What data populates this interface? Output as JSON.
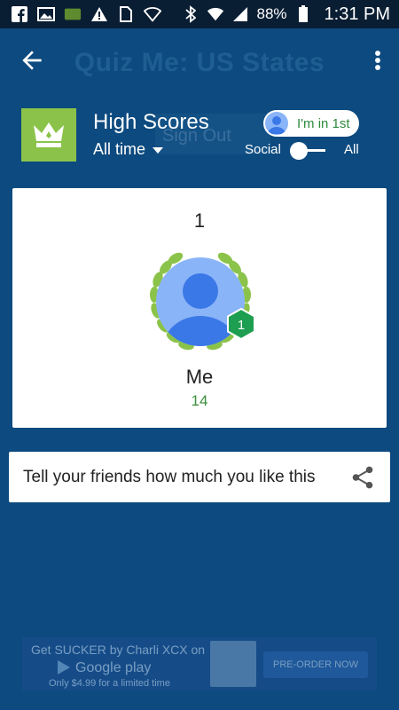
{
  "status_bar": {
    "battery": "88%",
    "time": "1:31 PM",
    "notification_badge": "88",
    "icons": [
      "facebook-icon",
      "image-icon",
      "badge-88-icon",
      "warning-icon",
      "sim-icon",
      "wifi-icon"
    ],
    "right_icons": [
      "bluetooth-icon",
      "wifi-icon",
      "signal-icon",
      "battery-icon"
    ]
  },
  "app_bar": {
    "title": "Quiz Me: US States",
    "back_icon": "arrow-back-icon",
    "menu_icon": "more-vert-icon"
  },
  "header": {
    "title": "High Scores",
    "time_filter": "All time",
    "ghost_button": "Sign Out",
    "im_first_label": "I'm in 1st",
    "toggle_left": "Social",
    "toggle_right": "All"
  },
  "leaderboard": {
    "rank": "1",
    "badge_rank": "1",
    "player_name": "Me",
    "score": "14"
  },
  "share": {
    "text": "Tell your friends how much you like this",
    "icon": "share-icon"
  },
  "ad": {
    "line1": "Get SUCKER by Charli XCX on",
    "line2": "Google play",
    "line3": "Only $4.99 for a limited time",
    "button": "PRE-ORDER NOW"
  },
  "colors": {
    "background": "#0d4a7f",
    "crown_green": "#8bc34a",
    "score_green": "#3a8f3a",
    "badge_green": "#1e9e50"
  }
}
